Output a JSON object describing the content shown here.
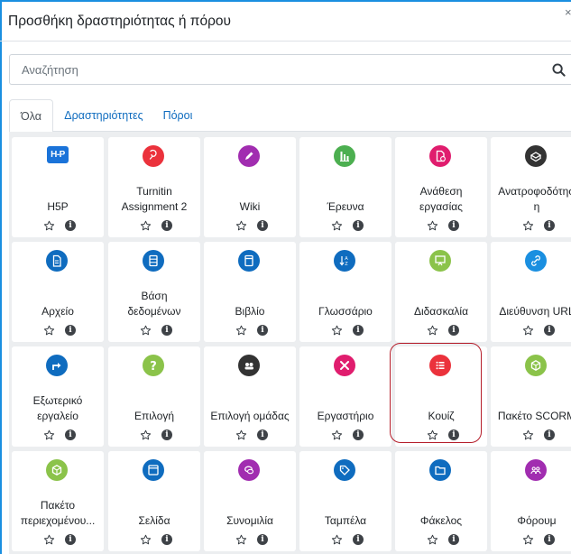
{
  "dialog": {
    "title": "Προσθήκη δραστηριότητας ή πόρου",
    "close_label": "×"
  },
  "search": {
    "placeholder": "Αναζήτηση",
    "value": ""
  },
  "tabs": [
    {
      "label": "Όλα",
      "active": true
    },
    {
      "label": "Δραστηριότητες",
      "active": false
    },
    {
      "label": "Πόροι",
      "active": false
    }
  ],
  "colors": {
    "link": "#0f6cbf",
    "highlight": "#b51d2a",
    "activity_pink": "#e01d6e",
    "activity_purple": "#a12db0",
    "activity_green": "#4caf50",
    "resource_blue": "#0f6cbf",
    "content_lime": "#8bc34a",
    "red": "#eb323c",
    "dark": "#333333",
    "h5p_blue": "#1a73d9"
  },
  "modules": [
    {
      "label": "H5P",
      "icon": "h5p-logo-icon",
      "color": "#1a73d9"
    },
    {
      "label": "Turnitin\nAssignment 2",
      "icon": "turnitin-icon",
      "color": "#eb323c"
    },
    {
      "label": "Wiki",
      "icon": "pencil-icon",
      "color": "#a12db0"
    },
    {
      "label": "Έρευνα",
      "icon": "chart-icon",
      "color": "#4caf50"
    },
    {
      "label": "Ανάθεση\nεργασίας",
      "icon": "document-check-icon",
      "color": "#e01d6e"
    },
    {
      "label": "Ανατροφοδότησ\nη",
      "icon": "megaphone-icon",
      "color": "#333333"
    },
    {
      "label": "Αρχείο",
      "icon": "file-icon",
      "color": "#0f6cbf"
    },
    {
      "label": "Βάση\nδεδομένων",
      "icon": "database-icon",
      "color": "#0f6cbf"
    },
    {
      "label": "Βιβλίο",
      "icon": "book-icon",
      "color": "#0f6cbf"
    },
    {
      "label": "Γλωσσάριο",
      "icon": "sort-az-icon",
      "color": "#0f6cbf"
    },
    {
      "label": "Διδασκαλία",
      "icon": "presentation-icon",
      "color": "#8bc34a"
    },
    {
      "label": "Διεύθυνση URL",
      "icon": "link-icon",
      "color": "#1a8fe0"
    },
    {
      "label": "Εξωτερικό\nεργαλείο",
      "icon": "external-icon",
      "color": "#0f6cbf"
    },
    {
      "label": "Επιλογή",
      "icon": "question-icon",
      "color": "#8bc34a"
    },
    {
      "label": "Επιλογή ομάδας",
      "icon": "group-icon",
      "color": "#333333"
    },
    {
      "label": "Εργαστήριο",
      "icon": "tools-icon",
      "color": "#e01d6e"
    },
    {
      "label": "Κουίζ",
      "icon": "quiz-list-icon",
      "color": "#eb323c"
    },
    {
      "label": "Πακέτο SCORM",
      "icon": "package-icon",
      "color": "#8bc34a"
    },
    {
      "label": "Πακέτο\nπεριεχομένου...",
      "icon": "content-package-icon",
      "color": "#8bc34a"
    },
    {
      "label": "Σελίδα",
      "icon": "page-icon",
      "color": "#0f6cbf"
    },
    {
      "label": "Συνομιλία",
      "icon": "chat-icon",
      "color": "#a12db0"
    },
    {
      "label": "Ταμπέλα",
      "icon": "tag-icon",
      "color": "#0f6cbf"
    },
    {
      "label": "Φάκελος",
      "icon": "folder-icon",
      "color": "#0f6cbf"
    },
    {
      "label": "Φόρουμ",
      "icon": "forum-icon",
      "color": "#a12db0"
    }
  ]
}
